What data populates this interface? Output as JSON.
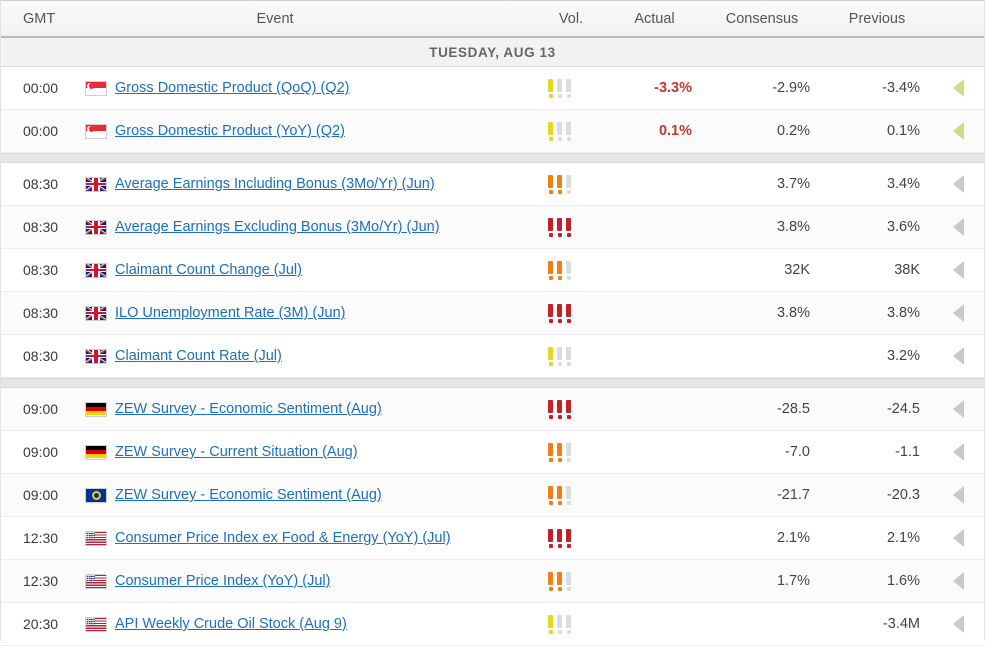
{
  "header": {
    "time_label": "GMT",
    "event_label": "Event",
    "vol_label": "Vol.",
    "actual_label": "Actual",
    "consensus_label": "Consensus",
    "previous_label": "Previous"
  },
  "day_band": "TUESDAY, AUG 13",
  "colors": {
    "link": "#1d6fc0",
    "actual": "#c0392b",
    "vol_low": "#e8d61d",
    "vol_medium": "#ef8017",
    "vol_high": "#c2202a",
    "vol_off": "#dcdcdc",
    "arrow_active": "#c5e085",
    "arrow_inactive": "#c9c9c9"
  },
  "groups": [
    {
      "country": "sg",
      "rows": [
        {
          "time": "00:00",
          "flag": "sg",
          "flag_name": "flag-singapore",
          "event": "Gross Domestic Product (QoQ) (Q2)",
          "volatility": 1,
          "actual": "-3.3%",
          "consensus": "-2.9%",
          "previous": "-3.4%",
          "arrow": "green",
          "arrow_name": "expand-row-arrow"
        },
        {
          "time": "00:00",
          "flag": "sg",
          "flag_name": "flag-singapore",
          "event": "Gross Domestic Product (YoY) (Q2)",
          "volatility": 1,
          "actual": "0.1%",
          "consensus": "0.2%",
          "previous": "0.1%",
          "arrow": "green",
          "arrow_name": "expand-row-arrow"
        }
      ]
    },
    {
      "country": "uk",
      "rows": [
        {
          "time": "08:30",
          "flag": "uk",
          "flag_name": "flag-united-kingdom",
          "event": "Average Earnings Including Bonus (3Mo/Yr) (Jun)",
          "volatility": 2,
          "actual": "",
          "consensus": "3.7%",
          "previous": "3.4%",
          "arrow": "gray",
          "arrow_name": "expand-row-arrow"
        },
        {
          "time": "08:30",
          "flag": "uk",
          "flag_name": "flag-united-kingdom",
          "event": "Average Earnings Excluding Bonus (3Mo/Yr) (Jun)",
          "volatility": 3,
          "actual": "",
          "consensus": "3.8%",
          "previous": "3.6%",
          "arrow": "gray",
          "arrow_name": "expand-row-arrow"
        },
        {
          "time": "08:30",
          "flag": "uk",
          "flag_name": "flag-united-kingdom",
          "event": "Claimant Count Change (Jul)",
          "volatility": 2,
          "actual": "",
          "consensus": "32K",
          "previous": "38K",
          "arrow": "gray",
          "arrow_name": "expand-row-arrow"
        },
        {
          "time": "08:30",
          "flag": "uk",
          "flag_name": "flag-united-kingdom",
          "event": "ILO Unemployment Rate (3M) (Jun)",
          "volatility": 3,
          "actual": "",
          "consensus": "3.8%",
          "previous": "3.8%",
          "arrow": "gray",
          "arrow_name": "expand-row-arrow"
        },
        {
          "time": "08:30",
          "flag": "uk",
          "flag_name": "flag-united-kingdom",
          "event": "Claimant Count Rate (Jul)",
          "volatility": 1,
          "actual": "",
          "consensus": "",
          "previous": "3.2%",
          "arrow": "gray",
          "arrow_name": "expand-row-arrow"
        }
      ]
    },
    {
      "country": "de",
      "rows": [
        {
          "time": "09:00",
          "flag": "de",
          "flag_name": "flag-germany",
          "event": "ZEW Survey - Economic Sentiment (Aug)",
          "volatility": 3,
          "actual": "",
          "consensus": "-28.5",
          "previous": "-24.5",
          "arrow": "gray",
          "arrow_name": "expand-row-arrow"
        },
        {
          "time": "09:00",
          "flag": "de",
          "flag_name": "flag-germany",
          "event": "ZEW Survey - Current Situation (Aug)",
          "volatility": 2,
          "actual": "",
          "consensus": "-7.0",
          "previous": "-1.1",
          "arrow": "gray",
          "arrow_name": "expand-row-arrow"
        },
        {
          "time": "09:00",
          "flag": "eu",
          "flag_name": "flag-european-union",
          "event": "ZEW Survey - Economic Sentiment (Aug)",
          "volatility": 2,
          "actual": "",
          "consensus": "-21.7",
          "previous": "-20.3",
          "arrow": "gray",
          "arrow_name": "expand-row-arrow"
        },
        {
          "time": "12:30",
          "flag": "us",
          "flag_name": "flag-united-states",
          "event": "Consumer Price Index ex Food & Energy (YoY) (Jul)",
          "volatility": 3,
          "actual": "",
          "consensus": "2.1%",
          "previous": "2.1%",
          "arrow": "gray",
          "arrow_name": "expand-row-arrow"
        },
        {
          "time": "12:30",
          "flag": "us",
          "flag_name": "flag-united-states",
          "event": "Consumer Price Index (YoY) (Jul)",
          "volatility": 2,
          "actual": "",
          "consensus": "1.7%",
          "previous": "1.6%",
          "arrow": "gray",
          "arrow_name": "expand-row-arrow"
        },
        {
          "time": "20:30",
          "flag": "us",
          "flag_name": "flag-united-states",
          "event": "API Weekly Crude Oil Stock (Aug 9)",
          "volatility": 1,
          "actual": "",
          "consensus": "",
          "previous": "-3.4M",
          "arrow": "gray",
          "arrow_name": "expand-row-arrow"
        }
      ]
    }
  ]
}
